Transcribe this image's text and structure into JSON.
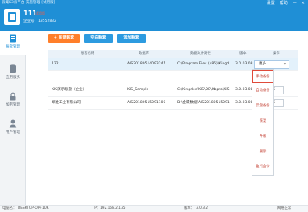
{
  "window": {
    "title": "云翼K3云平台-实施管理 [试用版]",
    "controls": [
      "设置",
      "帮助",
      "—",
      "×"
    ]
  },
  "user": {
    "name": "111",
    "tag": "试用版",
    "company_label": "企业号：",
    "company_id": "13552832"
  },
  "sidebar": {
    "items": [
      {
        "label": "账套管理",
        "icon": "ledger-icon",
        "active": true
      },
      {
        "label": "应用服务",
        "icon": "database-icon",
        "active": false
      },
      {
        "label": "加密管理",
        "icon": "lock-icon",
        "active": false
      },
      {
        "label": "用户管理",
        "icon": "user-icon",
        "active": false
      }
    ]
  },
  "toolbar": {
    "new_label": "新建账套",
    "new_icon": "plus-icon",
    "empty_label": "空白账套",
    "add_label": "添加账套"
  },
  "table": {
    "headers": [
      "账套名称",
      "数据库",
      "数据文件路径",
      "版本",
      "操作"
    ],
    "rows": [
      {
        "name": "122",
        "db": "AIS20180514093247",
        "path": "C:\\Program Files (x86)\\Kingd",
        "version": "3.0.03.08",
        "op": "更多"
      },
      {
        "name": "KIS演示账套（企业）",
        "db": "KIS_Sample",
        "path": "C:\\Kingdee\\KIS\\DB\\Kbpro\\KIS",
        "version": "3.0.03.08",
        "op": "更多"
      },
      {
        "name": "郑维工业有限公司",
        "db": "AIS20180515091106",
        "path": "D:\\金蝶数据\\AIS20180515091",
        "version": "3.0.03.08",
        "op": "更多"
      }
    ]
  },
  "dropdown": {
    "items": [
      "手动备份",
      "自动备份",
      "云盘备份",
      "恢复",
      "升级",
      "删除",
      "执行命令"
    ]
  },
  "status": {
    "computer_label": "电脑名：",
    "computer_name": "DESKTOP-OPF1UK",
    "ip_label": "IP：",
    "ip": "192.168.2.135",
    "version_label": "版本：",
    "version": "3.0.3.2",
    "network": "网络正常"
  },
  "colors": {
    "brand": "#1f8fd6",
    "accent_orange": "#ff7f2a",
    "menu_text": "#c0392b"
  }
}
